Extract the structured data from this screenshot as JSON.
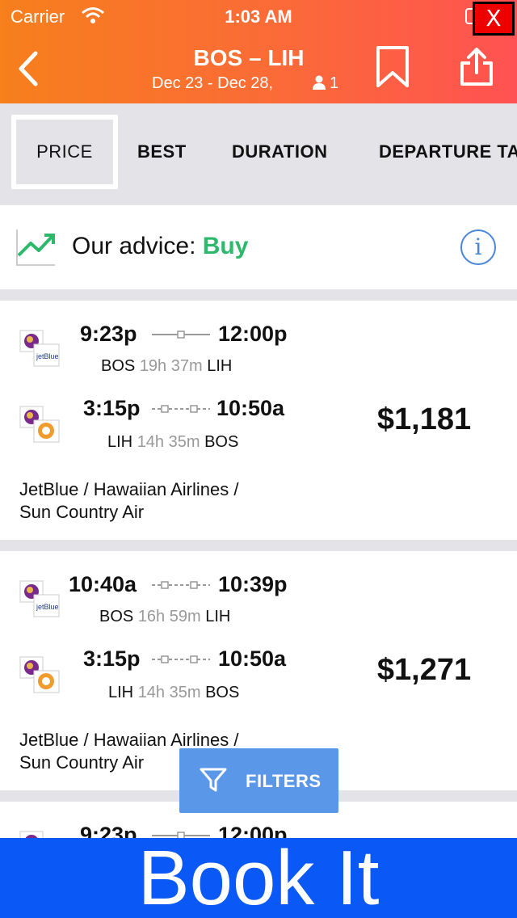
{
  "status_bar": {
    "carrier": "Carrier",
    "time": "1:03 AM",
    "close_label": "X"
  },
  "header": {
    "route": "BOS – LIH",
    "dates": "Dec 23 - Dec 28,",
    "passengers": "1"
  },
  "tabs": [
    "PRICE",
    "BEST",
    "DURATION",
    "DEPARTURE TA"
  ],
  "advice": {
    "label": "Our advice: ",
    "value": "Buy"
  },
  "results": [
    {
      "outbound": {
        "depart": "9:23p",
        "arrive": "12:00p",
        "from": "BOS",
        "duration": "19h 37m",
        "to": "LIH"
      },
      "return": {
        "depart": "3:15p",
        "arrive": "10:50a",
        "from": "LIH",
        "duration": "14h 35m",
        "to": "BOS"
      },
      "price": "$1,181",
      "airlines_line1": "JetBlue / Hawaiian Airlines /",
      "airlines_line2": "Sun Country Air"
    },
    {
      "outbound": {
        "depart": "10:40a",
        "arrive": "10:39p",
        "from": "BOS",
        "duration": "16h 59m",
        "to": "LIH"
      },
      "return": {
        "depart": "3:15p",
        "arrive": "10:50a",
        "from": "LIH",
        "duration": "14h 35m",
        "to": "BOS"
      },
      "price": "$1,271",
      "airlines_line1": "JetBlue / Hawaiian Airlines /",
      "airlines_line2": "Sun Country Air"
    },
    {
      "outbound": {
        "depart": "9:23p",
        "arrive": "12:00p"
      }
    }
  ],
  "filters_label": "FILTERS",
  "book_label": "Book It",
  "colors": {
    "accent_orange": "#f77f1c",
    "buy_green": "#2db86b",
    "book_blue": "#0a58f5",
    "filter_blue": "#5a97e8"
  }
}
